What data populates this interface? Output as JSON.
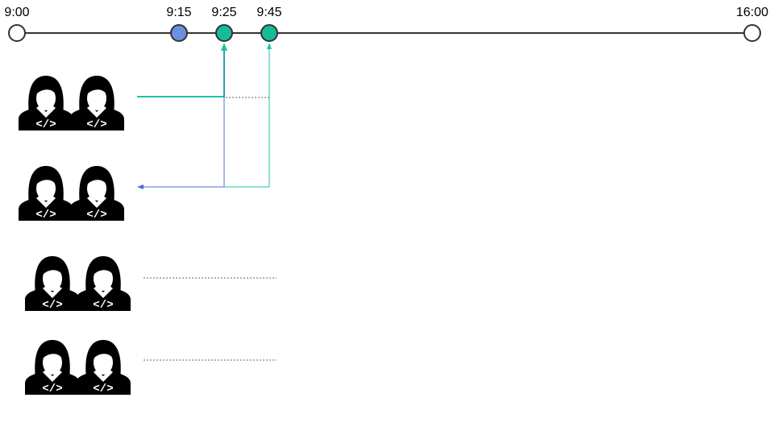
{
  "timeline": {
    "labels": {
      "start": "9:00",
      "t1": "9:15",
      "t2": "9:25",
      "t3": "9:45",
      "end": "16:00"
    }
  },
  "pairs": {
    "count": 4,
    "icon": "developer-pair-icon",
    "code_glyph": "</>"
  },
  "colors": {
    "axis": "#333333",
    "marker_blue": "#6d8fe0",
    "marker_teal": "#16bc98",
    "teal_line": "#1cc4a4",
    "blue_line": "#4a6fcf",
    "dotted": "#666666",
    "icon": "#000000"
  }
}
